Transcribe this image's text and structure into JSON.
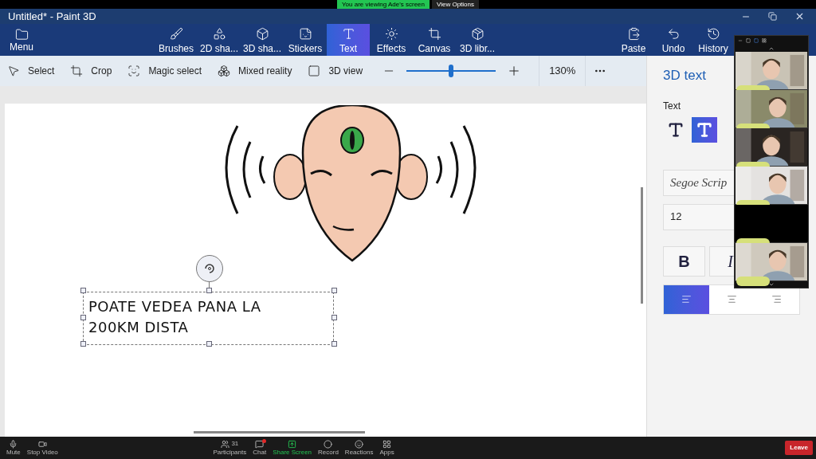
{
  "meeting_banner": {
    "text": "You are viewing Ade's screen",
    "view_options": "View Options"
  },
  "window": {
    "title": "Untitled* - Paint 3D"
  },
  "menu": {
    "label": "Menu"
  },
  "tools": [
    {
      "kind": "brush",
      "label": "Brushes",
      "selected": false
    },
    {
      "kind": "shapes2d",
      "label": "2D sha...",
      "selected": false
    },
    {
      "kind": "shapes3d",
      "label": "3D sha...",
      "selected": false
    },
    {
      "kind": "sticker",
      "label": "Stickers",
      "selected": false
    },
    {
      "kind": "text",
      "label": "Text",
      "selected": true
    },
    {
      "kind": "effects",
      "label": "Effects",
      "selected": false
    },
    {
      "kind": "canvas",
      "label": "Canvas",
      "selected": false
    },
    {
      "kind": "library",
      "label": "3D libr...",
      "selected": false
    }
  ],
  "actions": [
    {
      "kind": "paste",
      "label": "Paste"
    },
    {
      "kind": "undo",
      "label": "Undo"
    },
    {
      "kind": "history",
      "label": "History"
    }
  ],
  "subtoolbar": {
    "items": [
      {
        "kind": "select",
        "label": "Select"
      },
      {
        "kind": "crop",
        "label": "Crop"
      },
      {
        "kind": "magic",
        "label": "Magic select"
      },
      {
        "kind": "mixed",
        "label": "Mixed reality"
      },
      {
        "kind": "view3d",
        "label": "3D view"
      }
    ],
    "zoom": {
      "level": 0.5,
      "reading": "130%"
    }
  },
  "canvas": {
    "text_lines": [
      "POATE VEDEA PANA LA",
      "200KM DISTA"
    ]
  },
  "panel": {
    "title": "3D text",
    "section": "Text",
    "text_modes": [
      {
        "kind": "flat",
        "selected": false
      },
      {
        "kind": "extruded",
        "selected": true
      }
    ],
    "font": "Segoe Scrip",
    "size": "12",
    "styles": [
      {
        "kind": "bold",
        "label": "B",
        "selected": false
      },
      {
        "kind": "italic",
        "label": "I",
        "selected": false
      }
    ],
    "alignment": [
      {
        "kind": "left",
        "selected": true
      },
      {
        "kind": "center",
        "selected": false
      },
      {
        "kind": "right",
        "selected": false
      }
    ]
  },
  "video_panel": {
    "tiles": [
      {
        "kind": "person"
      },
      {
        "kind": "person"
      },
      {
        "kind": "person"
      },
      {
        "kind": "person"
      },
      {
        "kind": "blank"
      },
      {
        "kind": "person"
      }
    ]
  },
  "meeting_controls": [
    {
      "kind": "mute",
      "label": "Mute"
    },
    {
      "kind": "video",
      "label": "Stop Video"
    },
    {
      "kind": "participants",
      "label": "Participants",
      "count": "31"
    },
    {
      "kind": "chat",
      "label": "Chat"
    },
    {
      "kind": "share",
      "label": "Share Screen"
    },
    {
      "kind": "record",
      "label": "Record"
    },
    {
      "kind": "reactions",
      "label": "Reactions"
    },
    {
      "kind": "apps",
      "label": "Apps"
    }
  ],
  "leave": {
    "label": "Leave"
  }
}
